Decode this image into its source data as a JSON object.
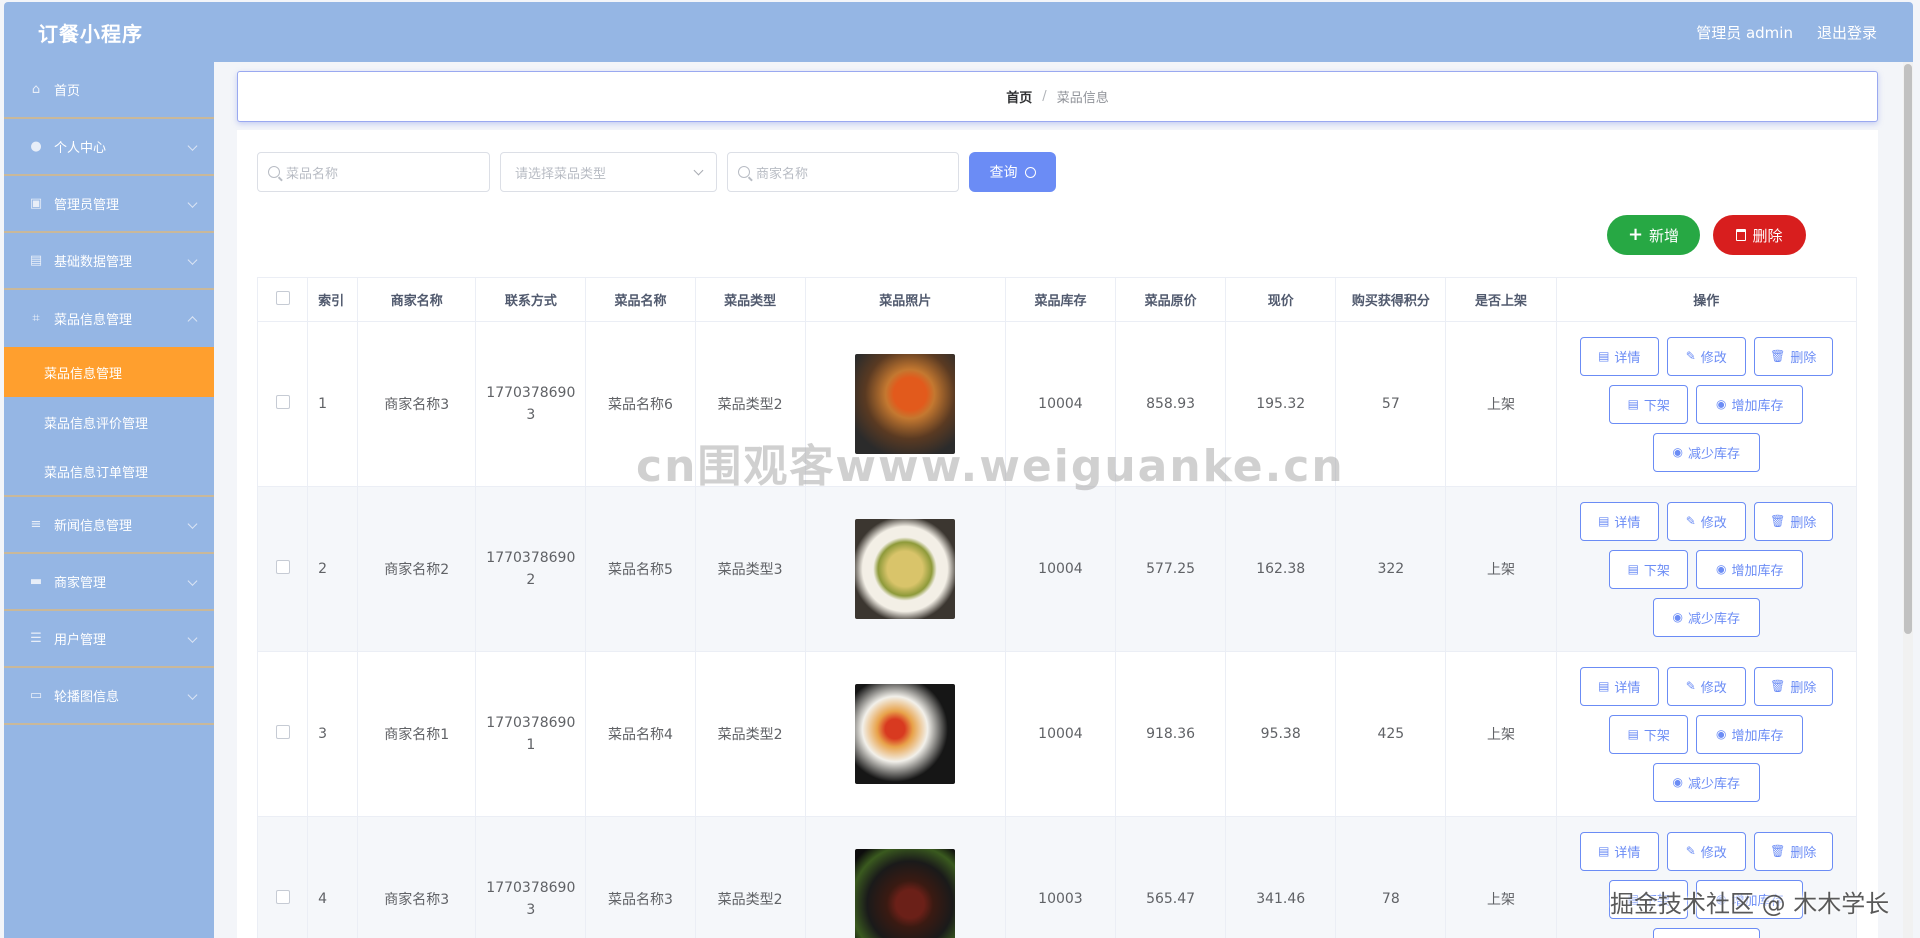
{
  "header": {
    "title": "订餐小程序",
    "user": "管理员 admin",
    "logout": "退出登录"
  },
  "sidebar": {
    "items": [
      {
        "label": "首页",
        "icon": "home-icon",
        "glyph": "⌂"
      },
      {
        "label": "个人中心",
        "icon": "user-icon",
        "glyph": "●"
      },
      {
        "label": "管理员管理",
        "icon": "chart-icon",
        "glyph": "▣"
      },
      {
        "label": "基础数据管理",
        "icon": "briefcase-icon",
        "glyph": "▤"
      },
      {
        "label": "菜品信息管理",
        "icon": "crop-icon",
        "glyph": "⌗"
      }
    ],
    "sub_items": [
      {
        "label": "菜品信息管理"
      },
      {
        "label": "菜品信息评价管理"
      },
      {
        "label": "菜品信息订单管理"
      }
    ],
    "items_after": [
      {
        "label": "新闻信息管理",
        "icon": "sliders-icon",
        "glyph": "≡"
      },
      {
        "label": "商家管理",
        "icon": "message-icon",
        "glyph": "▬"
      },
      {
        "label": "用户管理",
        "icon": "list-icon",
        "glyph": "☰"
      },
      {
        "label": "轮播图信息",
        "icon": "image-icon",
        "glyph": "▭"
      }
    ]
  },
  "breadcrumb": {
    "home": "首页",
    "current": "菜品信息"
  },
  "search": {
    "name_placeholder": "菜品名称",
    "type_placeholder": "请选择菜品类型",
    "merchant_placeholder": "商家名称",
    "query_label": "查询"
  },
  "actions": {
    "add_label": "新增",
    "delete_label": "删除"
  },
  "table": {
    "headers": [
      "索引",
      "商家名称",
      "联系方式",
      "菜品名称",
      "菜品类型",
      "菜品照片",
      "菜品库存",
      "菜品原价",
      "现价",
      "购买获得积分",
      "是否上架",
      "操作"
    ],
    "rows": [
      {
        "index": "1",
        "merchant": "商家名称3",
        "phone_a": "1770378690",
        "phone_b": "3",
        "dish": "菜品名称6",
        "type": "菜品类型2",
        "stock": "10004",
        "original": "858.93",
        "price": "195.32",
        "points": "57",
        "status": "上架"
      },
      {
        "index": "2",
        "merchant": "商家名称2",
        "phone_a": "1770378690",
        "phone_b": "2",
        "dish": "菜品名称5",
        "type": "菜品类型3",
        "stock": "10004",
        "original": "577.25",
        "price": "162.38",
        "points": "322",
        "status": "上架"
      },
      {
        "index": "3",
        "merchant": "商家名称1",
        "phone_a": "1770378690",
        "phone_b": "1",
        "dish": "菜品名称4",
        "type": "菜品类型2",
        "stock": "10004",
        "original": "918.36",
        "price": "95.38",
        "points": "425",
        "status": "上架"
      },
      {
        "index": "4",
        "merchant": "商家名称3",
        "phone_a": "1770378690",
        "phone_b": "3",
        "dish": "菜品名称3",
        "type": "菜品类型2",
        "stock": "10003",
        "original": "565.47",
        "price": "341.46",
        "points": "78",
        "status": "上架"
      }
    ],
    "row_buttons": {
      "detail": "详情",
      "edit": "修改",
      "delete": "删除",
      "off_shelf": "下架",
      "add_stock": "增加库存",
      "reduce_stock": "减少库存"
    }
  },
  "watermarks": {
    "center": "cn围观客www.weiguanke.cn",
    "corner": "掘金技术社区 @ 木木学长"
  },
  "colors": {
    "header_bg": "#95b6e4",
    "active_menu": "#ff9f2e",
    "primary": "#6b8cf5",
    "add_button": "#27a844",
    "delete_button": "#d81e1e"
  }
}
